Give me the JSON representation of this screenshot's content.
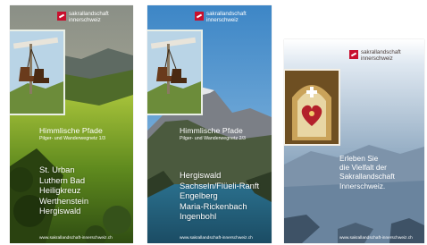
{
  "brochures": [
    {
      "logo": {
        "line1": "sakrallandschaft",
        "line2": "innerschweiz"
      },
      "title": "Himmlische Pfade",
      "subtitle": "Pilger- und Wanderwegnetz 1/3",
      "places": [
        "St. Urban",
        "Luthern Bad",
        "Heiligkreuz",
        "Werthenstein",
        "Hergiswald"
      ],
      "url": "www.sakrallandschaft-innerschweiz.ch"
    },
    {
      "logo": {
        "line1": "sakrallandschaft",
        "line2": "innerschweiz"
      },
      "title": "Himmlische Pfade",
      "subtitle": "Pilger- und Wanderwegnetz 2/3",
      "places": [
        "Hergiswald",
        "Sachseln/Flüeli-Ranft",
        "Engelberg",
        "Maria-Rickenbach",
        "Ingenbohl"
      ],
      "url": "www.sakrallandschaft-innerschweiz.ch"
    },
    {
      "logo": {
        "line1": "sakrallandschaft",
        "line2": "innerschweiz"
      },
      "tagline": [
        "Erleben Sie",
        "die Vielfalt der",
        "Sakrallandschaft",
        "Innerschweiz."
      ],
      "url": "www.sakrallandschaft-innerschweiz.ch"
    }
  ],
  "colors": {
    "brand_red": "#c8102e",
    "cover3_blue": "#6f8ca6",
    "logo_text_dark": "#4a3d3a"
  }
}
